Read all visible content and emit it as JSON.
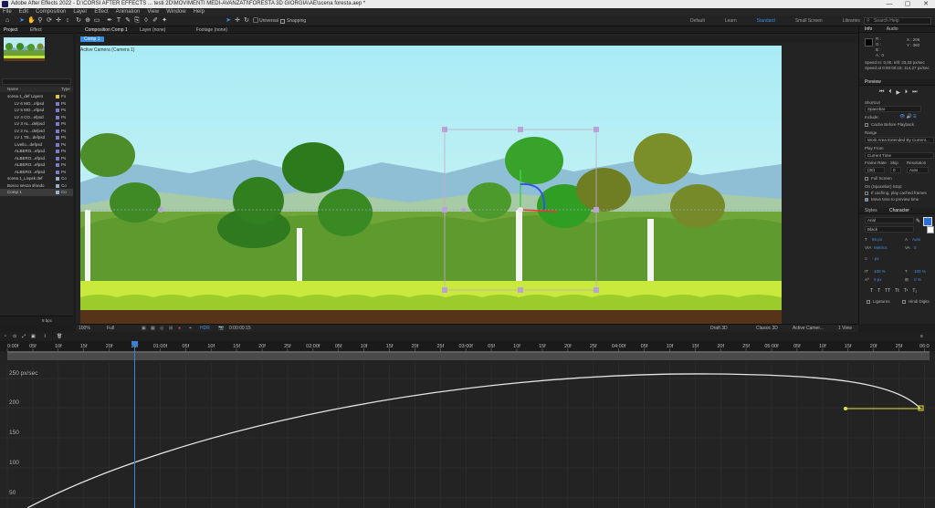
{
  "title_bar": {
    "title": "Adobe After Effects 2022 - D:\\CORSI AFTER EFFECTS ... testi 2D\\MOVIMENTI MEDI-AVANZATI\\FORESTA 3D GIORGIA\\AE\\scena foresta.aep *",
    "controls": [
      "—",
      "▢",
      "✕"
    ]
  },
  "menu": [
    "File",
    "Edit",
    "Composition",
    "Layer",
    "Effect",
    "Animation",
    "View",
    "Window",
    "Help"
  ],
  "toolbar": {
    "universal_label": "Universal",
    "snapping_label": "Snapping"
  },
  "workspaces": {
    "items": [
      "Default",
      "Learn",
      "Standard",
      "Small Screen",
      "Libraries"
    ],
    "active": "Standard"
  },
  "search_help": {
    "placeholder": "Search Help"
  },
  "project_panel": {
    "tabs": [
      "Project",
      "Effect"
    ],
    "search_placeholder": "",
    "columns": [
      "Name",
      "Type"
    ],
    "items": [
      {
        "name": "scena 1_def Layers",
        "type": "Fo",
        "color": "#e6c53c"
      },
      {
        "name": "LV 6 MO...efpsd",
        "type": "Ps",
        "color": "#7c7ccf"
      },
      {
        "name": "LV 5 MO...efpsd",
        "type": "Ps",
        "color": "#7c7ccf"
      },
      {
        "name": "LV 4 CO...efpsd",
        "type": "Ps",
        "color": "#7c7ccf"
      },
      {
        "name": "LV 3 AL...defpsd",
        "type": "Ps",
        "color": "#7c7ccf"
      },
      {
        "name": "LV 2 AL...defpsd",
        "type": "Ps",
        "color": "#7c7ccf"
      },
      {
        "name": "LV 1 TE...defpsd",
        "type": "Ps",
        "color": "#7c7ccf"
      },
      {
        "name": "Livello...defpsd",
        "type": "Ps",
        "color": "#7c7ccf"
      },
      {
        "name": "ALBERO...efpsd",
        "type": "Ps",
        "color": "#7c7ccf"
      },
      {
        "name": "ALBERO...efpsd",
        "type": "Ps",
        "color": "#7c7ccf"
      },
      {
        "name": "ALBERO...efpsd",
        "type": "Ps",
        "color": "#7c7ccf"
      },
      {
        "name": "ALBERO...efpsd",
        "type": "Ps",
        "color": "#7c7ccf"
      },
      {
        "name": "scena 1_Livpsk def",
        "type": "Co",
        "color": "#9ab0c8"
      },
      {
        "name": "Bosco senza sfondo",
        "type": "Co",
        "color": "#9ab0c8"
      },
      {
        "name": "Comp 1",
        "type": "Co",
        "color": "#9ab0c8"
      }
    ],
    "footer_bpc": "8 bpc"
  },
  "composition_panel": {
    "tab_label": "Composition Comp 1",
    "layer_tab": "Layer (none)",
    "footage_tab": "Footage (none)",
    "breadcrumb": "Comp 1",
    "view_label": "Active Camera (Camera 1)",
    "zoom": "100%",
    "resolution": "Full",
    "timecode": "0:00:00:15",
    "hdr_label": "HDR",
    "renderer_label": "Draft 3D",
    "classic_label": "Classic 3D",
    "camera_select": "Active Camer...",
    "views_select": "1 View"
  },
  "info_panel": {
    "tabs": [
      "Info",
      "Audio"
    ],
    "r_label": "R :",
    "g_label": "G :",
    "b_label": "B :",
    "a_label": "A : 0",
    "x_label": "X : 206",
    "y_label": "Y : 360",
    "speed_in": "Speed In: 0,00, Infl: 33,33 px/sec",
    "speed_out": "Speed at 0:00:00:15: 114,27 px/sec"
  },
  "preview_panel": {
    "title": "Preview",
    "shortcut_label": "Shortcut",
    "shortcut_value": "Spacebar",
    "include_label": "Include:",
    "cache_label": "Cache Before Playback",
    "range_label": "Range",
    "range_value": "Work Area Extended By Current...",
    "play_from_label": "Play From",
    "play_from_value": "Current Time",
    "frame_rate_label": "Frame Rate",
    "skip_label": "Skip",
    "resolution_label": "Resolution",
    "frame_rate_value": "(30)",
    "skip_value": "0",
    "resolution_value": "Auto",
    "full_screen_label": "Full Screen",
    "on_stop_label": "On (Spacebar) Stop:",
    "if_caching_label": "If caching, play cached frames",
    "move_time_label": "Move time to preview time"
  },
  "character_panel": {
    "tabs": [
      "Styles",
      "Character"
    ],
    "font": "Arial",
    "style": "Black",
    "size": "56 px",
    "leading": "Auto",
    "kerning": "Metrics",
    "tracking": "0",
    "stroke": "- px",
    "vscale": "100 %",
    "hscale": "100 %",
    "baseline": "0 px",
    "tsume": "0 %",
    "ligatures_label": "Ligatures",
    "hindi_label": "Hindi Digits",
    "fill_color": "#2a6fd1"
  },
  "timeline": {
    "ruler_labels": [
      "0:00f",
      "05f",
      "10f",
      "15f",
      "20f",
      "25f",
      "01:00f",
      "05f",
      "10f",
      "15f",
      "20f",
      "25f",
      "02:00f",
      "05f",
      "10f",
      "15f",
      "20f",
      "25f",
      "03:00f",
      "05f",
      "10f",
      "15f",
      "20f",
      "25f",
      "04:00f",
      "05f",
      "10f",
      "15f",
      "20f",
      "25f",
      "05:00f",
      "05f",
      "10f",
      "15f",
      "20f",
      "25f",
      "06:0"
    ],
    "graph_y_labels": [
      "250 px/sec",
      "200",
      "150",
      "100",
      "50"
    ],
    "playhead_color": "#3b82d6",
    "curve_color": "#e6e6e6",
    "key_color": "#e8e03a"
  }
}
